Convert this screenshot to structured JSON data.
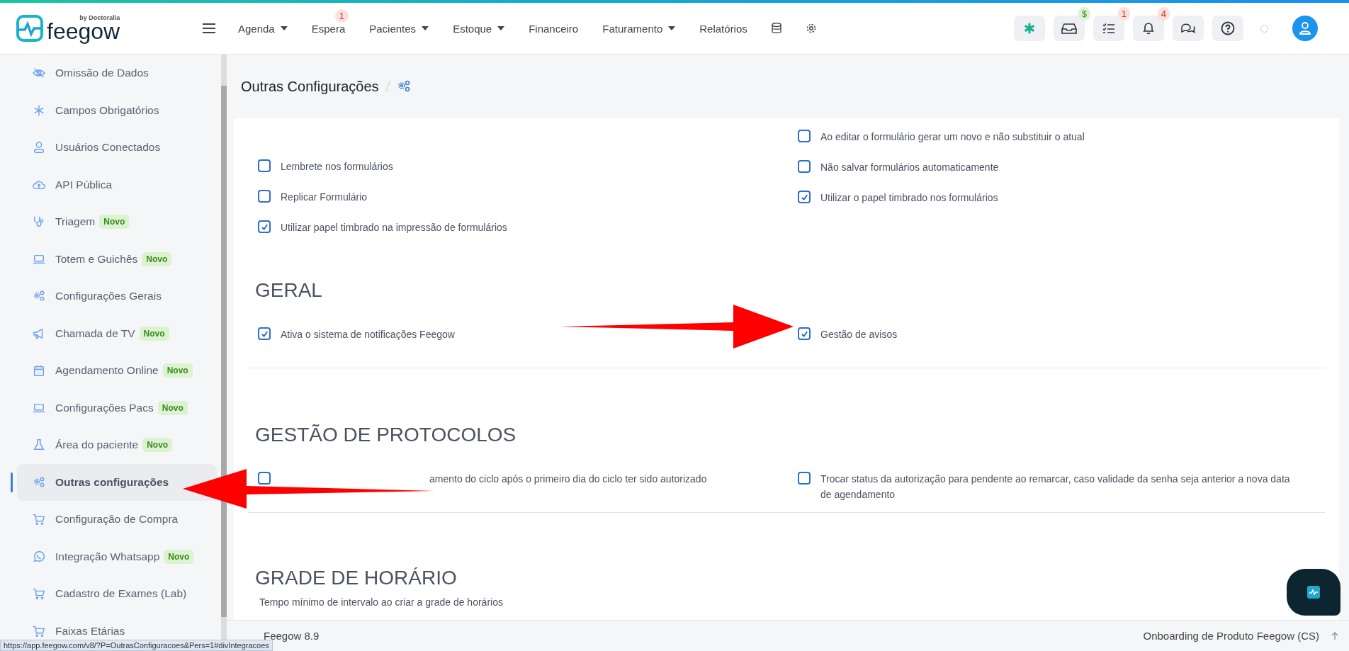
{
  "header": {
    "logo": {
      "name": "feegow",
      "byline": "by Doctoralia"
    },
    "nav": [
      {
        "label": "Agenda",
        "dropdown": true
      },
      {
        "label": "Espera",
        "dropdown": false,
        "badge": "1"
      },
      {
        "label": "Pacientes",
        "dropdown": true
      },
      {
        "label": "Estoque",
        "dropdown": true
      },
      {
        "label": "Financeiro",
        "dropdown": false
      },
      {
        "label": "Faturamento",
        "dropdown": true
      },
      {
        "label": "Relatórios",
        "dropdown": false
      }
    ],
    "actions": [
      {
        "kind": "brand"
      },
      {
        "kind": "inbox",
        "badge": "$",
        "color": "#3a8a1e"
      },
      {
        "kind": "tasks",
        "badge": "1",
        "color": "#c0392b"
      },
      {
        "kind": "bell",
        "badge": "4",
        "color": "#c0392b"
      },
      {
        "kind": "chat"
      },
      {
        "kind": "help"
      }
    ]
  },
  "sidebar": {
    "items": [
      {
        "label": "Omissão de Dados",
        "kind": "eye-off",
        "selected": false
      },
      {
        "label": "Campos Obrigatórios",
        "kind": "asterisk",
        "selected": false
      },
      {
        "label": "Usuários Conectados",
        "kind": "user",
        "selected": false
      },
      {
        "label": "API Pública",
        "kind": "cloud",
        "selected": false
      },
      {
        "label": "Triagem",
        "kind": "stethoscope",
        "badge": "Novo",
        "selected": false
      },
      {
        "label": "Totem e Guichês",
        "kind": "laptop",
        "badge": "Novo",
        "selected": false
      },
      {
        "label": "Configurações Gerais",
        "kind": "gears",
        "selected": false
      },
      {
        "label": "Chamada de TV",
        "kind": "megaphone",
        "badge": "Novo",
        "selected": false
      },
      {
        "label": "Agendamento Online",
        "kind": "calendar",
        "badge": "Novo",
        "selected": false
      },
      {
        "label": "Configurações Pacs",
        "kind": "laptop",
        "badge": "Novo",
        "selected": false
      },
      {
        "label": "Área do paciente",
        "kind": "flask",
        "badge": "Novo",
        "selected": false
      },
      {
        "label": "Outras configurações",
        "kind": "gears",
        "selected": true
      },
      {
        "label": "Configuração de Compra",
        "kind": "cart",
        "selected": false
      },
      {
        "label": "Integração Whatsapp",
        "kind": "whatsapp",
        "badge": "Novo",
        "selected": false
      },
      {
        "label": "Cadastro de Exames (Lab)",
        "kind": "cart",
        "selected": false
      },
      {
        "label": "Faixas Etárias",
        "kind": "cart",
        "selected": false
      }
    ]
  },
  "page": {
    "title": "Outras Configurações"
  },
  "sections": [
    {
      "columns": [
        [
          {
            "label": "Lembrete nos formulários",
            "checked": false
          },
          {
            "label": "Replicar Formulário",
            "checked": false
          },
          {
            "label": "Utilizar papel timbrado na impressão de formulários",
            "checked": true
          }
        ],
        [
          {
            "label": "Ao editar o formulário gerar um novo e não substituir o atual",
            "checked": false
          },
          {
            "label": "Não salvar formulários automaticamente",
            "checked": false
          },
          {
            "label": "Utilizar o papel timbrado nos formulários",
            "checked": true
          }
        ]
      ]
    },
    {
      "title": "GERAL",
      "columns": [
        [
          {
            "label": "Ativa o sistema de notificações Feegow",
            "checked": true
          }
        ],
        [
          {
            "label": "Gestão de avisos",
            "checked": true
          }
        ]
      ]
    },
    {
      "title": "GESTÃO DE PROTOCOLOS",
      "columns": [
        [
          {
            "label": "amento do ciclo após o primeiro dia do ciclo ter sido autorizado",
            "checked": false
          }
        ],
        [
          {
            "label": "Trocar status da autorização para pendente ao remarcar, caso validade da senha seja anterior a nova data de agendamento",
            "checked": false
          }
        ]
      ]
    },
    {
      "title": "GRADE DE HORÁRIO",
      "text": "Tempo mínimo de intervalo ao criar a grade de horários"
    }
  ],
  "footer": {
    "version": "Feegow 8.9",
    "right": "Onboarding de Produto Feegow (CS)",
    "status_url": "https://app.feegow.com/v8/?P=OutrasConfiguracoes&Pers=1#divIntegracoes"
  }
}
